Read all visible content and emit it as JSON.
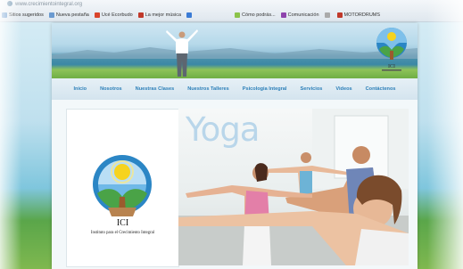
{
  "browser": {
    "address": "www.crecimientointegral.org",
    "bookmarks": [
      {
        "label": "Sitios sugeridos",
        "icon": "page-icon",
        "color": "#5a8fc9"
      },
      {
        "label": "Nueva pestaña",
        "icon": "page-icon",
        "color": "#6a9ad0"
      },
      {
        "label": "Ucé Ecorbudo",
        "icon": "play-icon",
        "color": "#d9442b"
      },
      {
        "label": "La mejor música",
        "icon": "music-icon",
        "color": "#c0392b"
      },
      {
        "label": "",
        "icon": "calendar-icon",
        "color": "#3a7bd5"
      },
      {
        "label": "Cómo podrás...",
        "icon": "page-icon",
        "color": "#8bc34a"
      },
      {
        "label": "Comunicación",
        "icon": "photo-icon",
        "color": "#8e44ad"
      },
      {
        "label": "",
        "icon": "page-icon",
        "color": "#aaaaaa"
      },
      {
        "label": "MOTORDRUMS",
        "icon": "music-icon",
        "color": "#c0392b"
      }
    ]
  },
  "site": {
    "banner_logo_text": "ICI",
    "nav": [
      "Inicio",
      "Nosotros",
      "Nuestras Clases",
      "Nuestros Talleres",
      "Psicologia Integral",
      "Servicios",
      "Videos",
      "Contáctenos"
    ],
    "logo_title": "ICI",
    "logo_subtitle": "Instituto para el Crecimiento Integral",
    "hero_title": "Yoga"
  },
  "colors": {
    "nav_link": "#2c7fb8",
    "logo_green": "#4aa347",
    "logo_blue": "#2b86c5",
    "logo_sun": "#f6d31e"
  }
}
